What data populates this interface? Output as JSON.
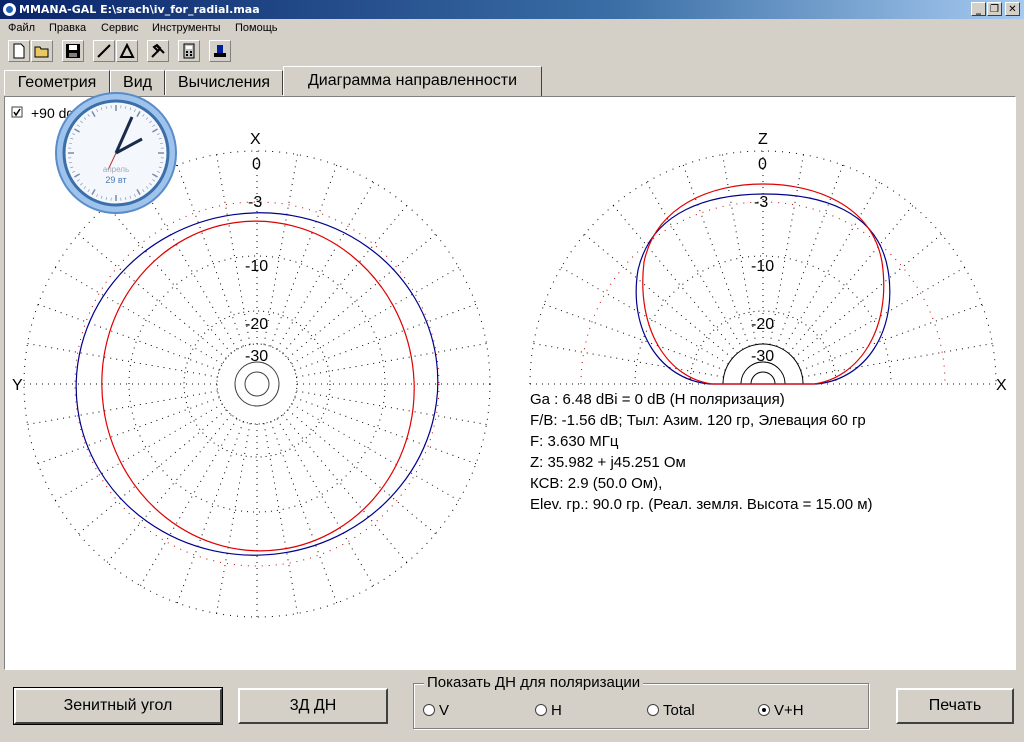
{
  "window": {
    "title": "MMANA-GAL E:\\srach\\iv_for_radial.maa",
    "minimize_glyph": "_",
    "restore_glyph": "❐",
    "close_glyph": "✕"
  },
  "menu": [
    "Файл",
    "Правка",
    "Сервис",
    "Инструменты",
    "Помощь"
  ],
  "toolbar_icons": [
    "new-file-icon",
    "open-folder-icon",
    "save-icon",
    "line-icon",
    "triangle-icon",
    "tools-icon",
    "calculator-icon",
    "run-icon"
  ],
  "tabs": [
    "Геометрия",
    "Вид",
    "Вычисления",
    "Диаграмма направленности"
  ],
  "active_tab": "Диаграмма направленности",
  "checkbox_label": "+90 dg",
  "left_plot": {
    "top_axis": "X",
    "side_axis": "Y",
    "ring_labels": [
      "0",
      "-3",
      "-10",
      "-20",
      "-30"
    ],
    "series_colors": {
      "V": "#0000a0",
      "H": "#e00000"
    }
  },
  "right_plot": {
    "top_axis": "Z",
    "side_axis": "X",
    "ring_labels": [
      "0",
      "-3",
      "-10",
      "-20",
      "-30"
    ]
  },
  "clock": {
    "month": "апрель",
    "day": "29 вт"
  },
  "results": [
    "Ga : 6.48 dBi = 0 dB  (H поляризация)",
    "F/B: -1.56 dB; Тыл: Азим. 120 гр, Элевация 60 гр",
    "F: 3.630 МГц",
    "Z: 35.982 + j45.251 Ом",
    "КСВ: 2.9 (50.0 Ом),",
    "Elev. гр.: 90.0 гр. (Реал. земля. Высота = 15.00 м)"
  ],
  "buttons": {
    "zenith": "Зенитный угол",
    "three_d": "3Д   ДН",
    "print": "Печать"
  },
  "polarization": {
    "label": "Показать ДН для поляризации",
    "options": [
      "V",
      "H",
      "Total",
      "V+H"
    ],
    "selected": "V+H"
  }
}
